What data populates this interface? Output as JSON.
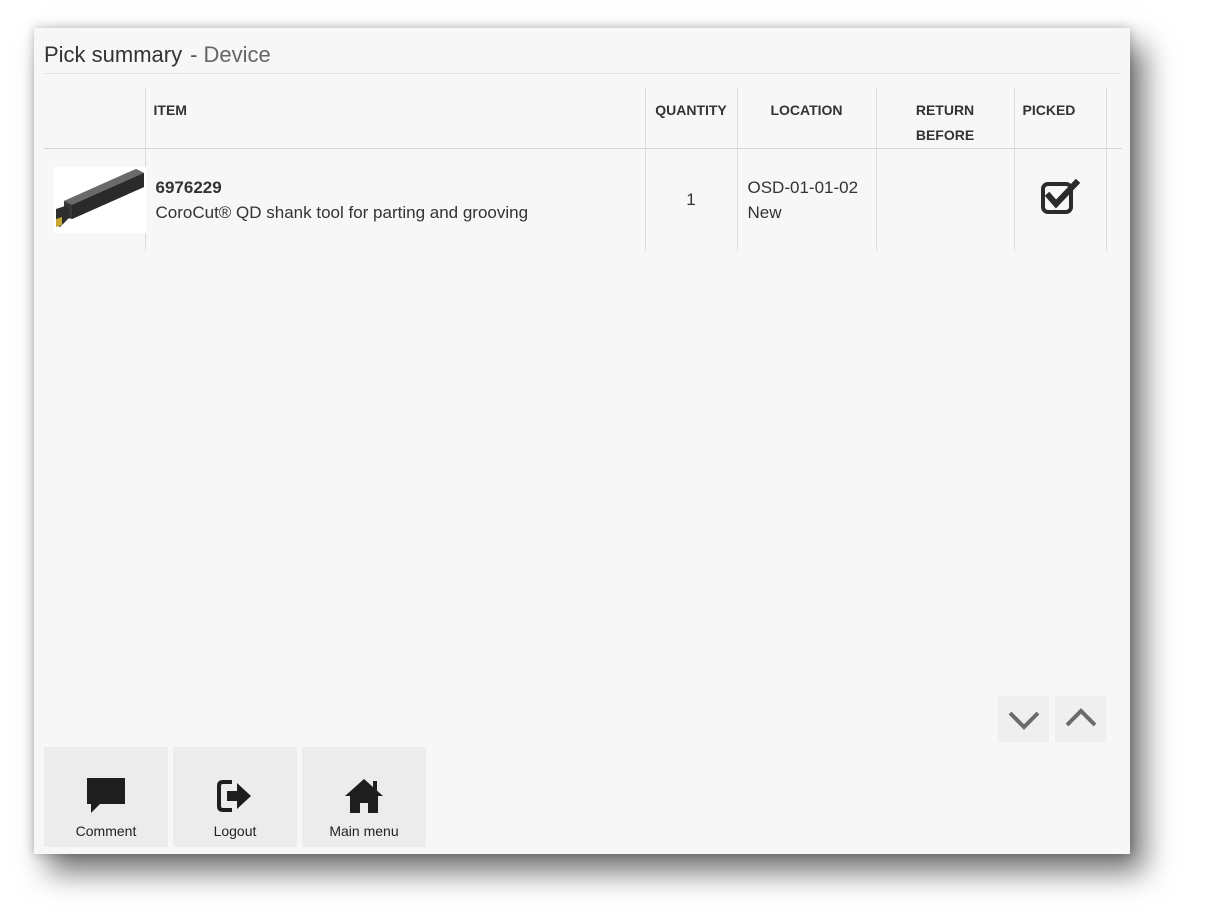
{
  "header": {
    "title": "Pick summary",
    "separator": "-",
    "subtitle": "Device"
  },
  "table": {
    "columns": {
      "item": "ITEM",
      "quantity": "QUANTITY",
      "location": "LOCATION",
      "return_before_line1": "RETURN",
      "return_before_line2": "BEFORE",
      "picked": "PICKED"
    },
    "rows": [
      {
        "item_number": "6976229",
        "description": "CoroCut® QD shank tool for parting and grooving",
        "quantity": "1",
        "location": "OSD-01-01-02",
        "condition": "New",
        "return_before": "",
        "picked": true,
        "image_icon": "shank-tool-image"
      }
    ]
  },
  "scroll": {
    "down_icon": "chevron-down-icon",
    "up_icon": "chevron-up-icon"
  },
  "footer": {
    "comment_label": "Comment",
    "logout_label": "Logout",
    "main_menu_label": "Main menu"
  },
  "colors": {
    "panel_background": "#f7f7f7",
    "button_background": "#ececec",
    "icon_color": "#222222",
    "chevron_color": "#6b6b6b"
  }
}
